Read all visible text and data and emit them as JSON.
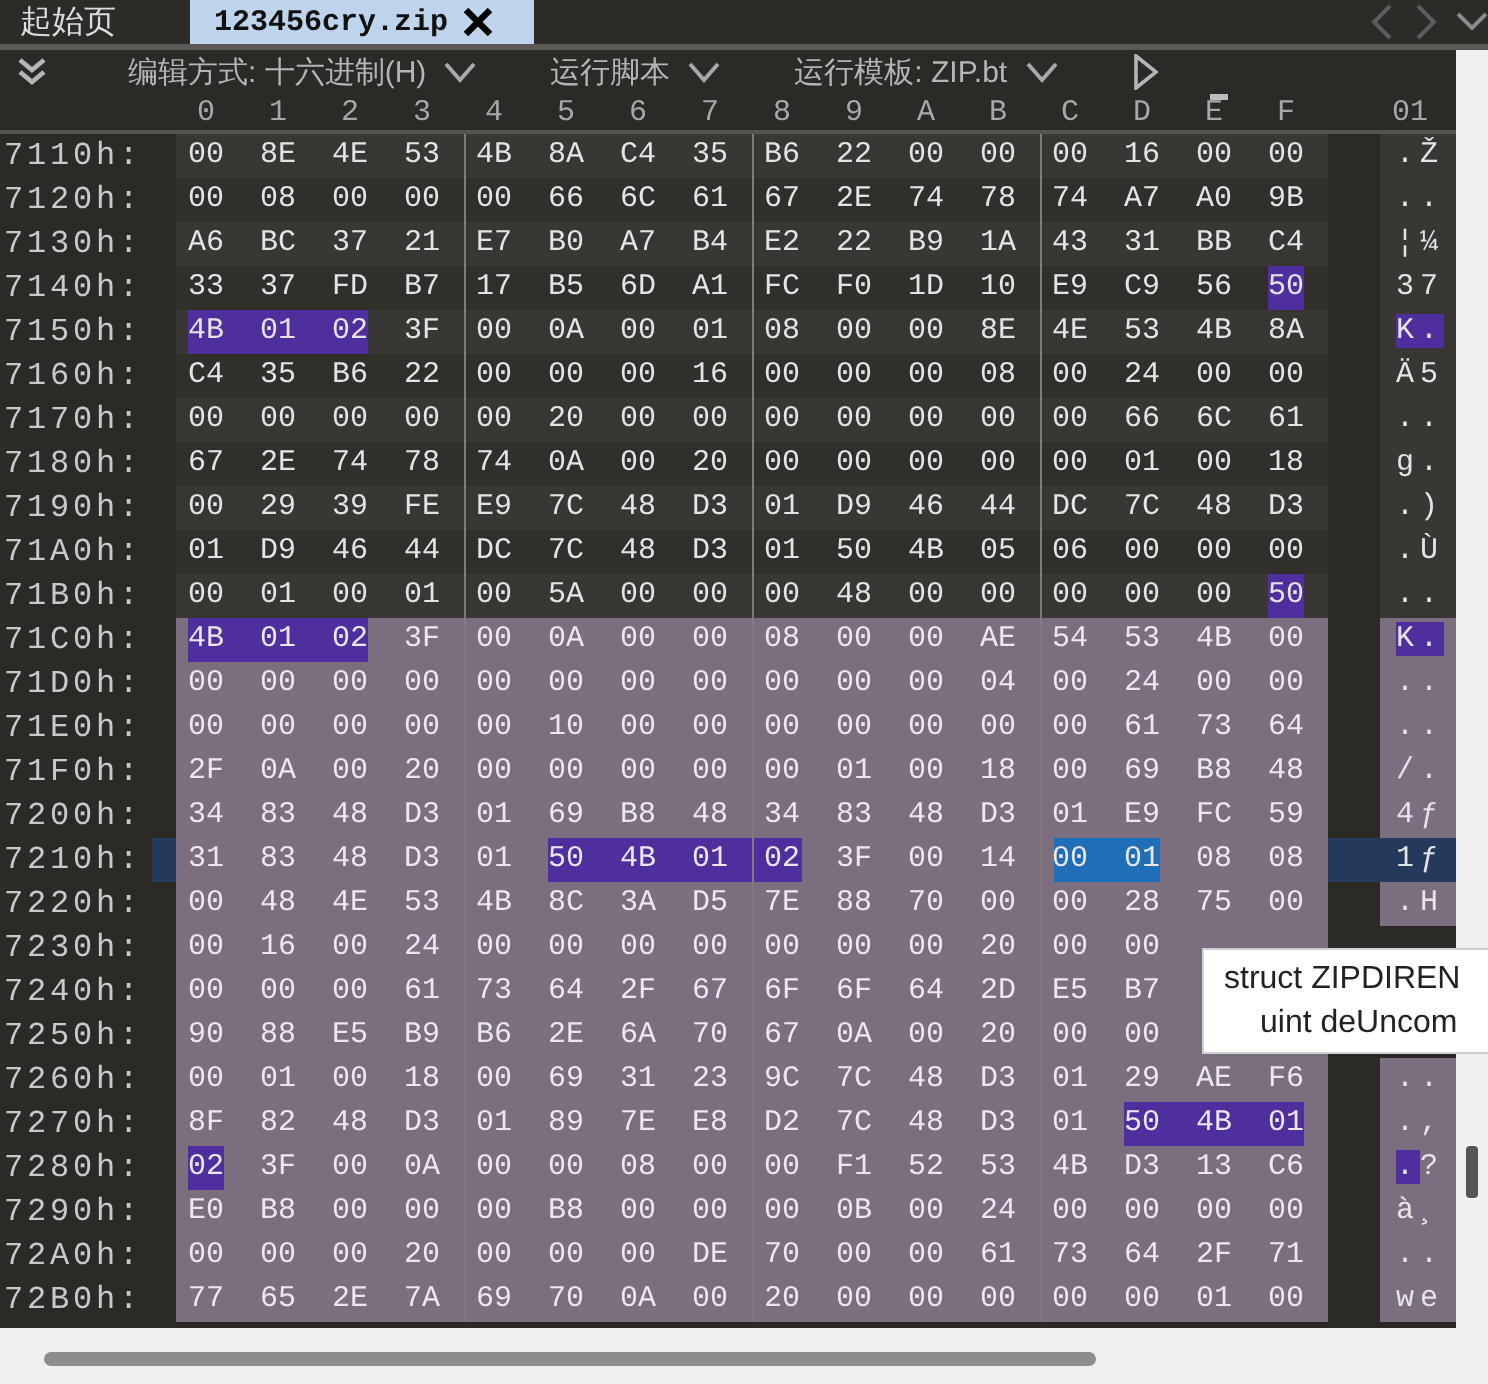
{
  "tabs": [
    {
      "label": "起始页",
      "selected": false
    },
    {
      "label": "123456cry.zip",
      "selected": true
    }
  ],
  "toolbar": {
    "dropdowns": [
      {
        "label": "编辑方式: 十六进制(H)"
      },
      {
        "label": "运行脚本"
      },
      {
        "label": "运行模板: ZIP.bt"
      }
    ]
  },
  "columns": [
    {
      "label": "0",
      "selected": false
    },
    {
      "label": "1",
      "selected": false
    },
    {
      "label": "2",
      "selected": false
    },
    {
      "label": "3",
      "selected": false
    },
    {
      "label": "4",
      "selected": false
    },
    {
      "label": "5",
      "selected": false
    },
    {
      "label": "6",
      "selected": false
    },
    {
      "label": "7",
      "selected": false
    },
    {
      "label": "8",
      "selected": false
    },
    {
      "label": "9",
      "selected": false
    },
    {
      "label": "A",
      "selected": false
    },
    {
      "label": "B",
      "selected": false
    },
    {
      "label": "C",
      "selected": false
    },
    {
      "label": "D",
      "selected": false
    },
    {
      "label": "E",
      "selected": true
    },
    {
      "label": "F",
      "selected": false
    }
  ],
  "ascii_header": "01",
  "rows": [
    {
      "address": "7110h:",
      "in_struct": false,
      "current": false,
      "segments": [
        {
          "kind": "plain",
          "bytes": [
            "00",
            "8E",
            "4E",
            "53",
            "4B",
            "8A",
            "C4",
            "35",
            "B6",
            "22",
            "00",
            "00",
            "00",
            "16",
            "00",
            "00"
          ]
        }
      ],
      "ascii": [
        {
          "kind": "plain",
          "text": ".Ž"
        }
      ]
    },
    {
      "address": "7120h:",
      "in_struct": false,
      "current": false,
      "segments": [
        {
          "kind": "plain",
          "bytes": [
            "00",
            "08",
            "00",
            "00",
            "00",
            "66",
            "6C",
            "61",
            "67",
            "2E",
            "74",
            "78",
            "74",
            "A7",
            "A0",
            "9B"
          ]
        }
      ],
      "ascii": [
        {
          "kind": "plain",
          "text": ".."
        }
      ]
    },
    {
      "address": "7130h:",
      "in_struct": false,
      "current": false,
      "segments": [
        {
          "kind": "plain",
          "bytes": [
            "A6",
            "BC",
            "37",
            "21",
            "E7",
            "B0",
            "A7",
            "B4",
            "E2",
            "22",
            "B9",
            "1A",
            "43",
            "31",
            "BB",
            "C4"
          ]
        }
      ],
      "ascii": [
        {
          "kind": "plain",
          "text": "¦¼"
        }
      ]
    },
    {
      "address": "7140h:",
      "in_struct": false,
      "current": false,
      "segments": [
        {
          "kind": "plain",
          "bytes": [
            "33",
            "37",
            "FD",
            "B7",
            "17",
            "B5",
            "6D",
            "A1",
            "FC",
            "F0",
            "1D",
            "10",
            "E9",
            "C9",
            "56"
          ]
        },
        {
          "kind": "signature",
          "bytes": [
            "50"
          ]
        }
      ],
      "ascii": [
        {
          "kind": "plain",
          "text": "37"
        }
      ]
    },
    {
      "address": "7150h:",
      "in_struct": false,
      "current": false,
      "segments": [
        {
          "kind": "signature",
          "bytes": [
            "4B",
            "01",
            "02"
          ]
        },
        {
          "kind": "plain",
          "bytes": [
            "3F",
            "00",
            "0A",
            "00",
            "01",
            "08",
            "00",
            "00",
            "8E",
            "4E",
            "53",
            "4B",
            "8A"
          ]
        }
      ],
      "ascii": [
        {
          "kind": "signature",
          "text": "K."
        }
      ]
    },
    {
      "address": "7160h:",
      "in_struct": false,
      "current": false,
      "segments": [
        {
          "kind": "plain",
          "bytes": [
            "C4",
            "35",
            "B6",
            "22",
            "00",
            "00",
            "00",
            "16",
            "00",
            "00",
            "00",
            "08",
            "00",
            "24",
            "00",
            "00"
          ]
        }
      ],
      "ascii": [
        {
          "kind": "plain",
          "text": "Ä5"
        }
      ]
    },
    {
      "address": "7170h:",
      "in_struct": false,
      "current": false,
      "segments": [
        {
          "kind": "plain",
          "bytes": [
            "00",
            "00",
            "00",
            "00",
            "00",
            "20",
            "00",
            "00",
            "00",
            "00",
            "00",
            "00",
            "00",
            "66",
            "6C",
            "61"
          ]
        }
      ],
      "ascii": [
        {
          "kind": "plain",
          "text": ".."
        }
      ]
    },
    {
      "address": "7180h:",
      "in_struct": false,
      "current": false,
      "segments": [
        {
          "kind": "plain",
          "bytes": [
            "67",
            "2E",
            "74",
            "78",
            "74",
            "0A",
            "00",
            "20",
            "00",
            "00",
            "00",
            "00",
            "00",
            "01",
            "00",
            "18"
          ]
        }
      ],
      "ascii": [
        {
          "kind": "plain",
          "text": "g."
        }
      ]
    },
    {
      "address": "7190h:",
      "in_struct": false,
      "current": false,
      "segments": [
        {
          "kind": "plain",
          "bytes": [
            "00",
            "29",
            "39",
            "FE",
            "E9",
            "7C",
            "48",
            "D3",
            "01",
            "D9",
            "46",
            "44",
            "DC",
            "7C",
            "48",
            "D3"
          ]
        }
      ],
      "ascii": [
        {
          "kind": "plain",
          "text": ".)"
        }
      ]
    },
    {
      "address": "71A0h:",
      "in_struct": false,
      "current": false,
      "segments": [
        {
          "kind": "plain",
          "bytes": [
            "01",
            "D9",
            "46",
            "44",
            "DC",
            "7C",
            "48",
            "D3",
            "01",
            "50",
            "4B",
            "05",
            "06",
            "00",
            "00",
            "00"
          ]
        }
      ],
      "ascii": [
        {
          "kind": "plain",
          "text": ".Ù"
        }
      ]
    },
    {
      "address": "71B0h:",
      "in_struct": false,
      "current": false,
      "segments": [
        {
          "kind": "plain",
          "bytes": [
            "00",
            "01",
            "00",
            "01",
            "00",
            "5A",
            "00",
            "00",
            "00",
            "48",
            "00",
            "00",
            "00",
            "00",
            "00"
          ]
        },
        {
          "kind": "signature",
          "bytes": [
            "50"
          ]
        }
      ],
      "ascii": [
        {
          "kind": "plain",
          "text": ".."
        }
      ]
    },
    {
      "address": "71C0h:",
      "in_struct": true,
      "current": false,
      "segments": [
        {
          "kind": "signature",
          "bytes": [
            "4B",
            "01",
            "02"
          ]
        },
        {
          "kind": "plain",
          "bytes": [
            "3F",
            "00",
            "0A",
            "00",
            "00",
            "08",
            "00",
            "00",
            "AE",
            "54",
            "53",
            "4B",
            "00"
          ]
        }
      ],
      "ascii": [
        {
          "kind": "signature",
          "text": "K."
        }
      ]
    },
    {
      "address": "71D0h:",
      "in_struct": true,
      "current": false,
      "segments": [
        {
          "kind": "plain",
          "bytes": [
            "00",
            "00",
            "00",
            "00",
            "00",
            "00",
            "00",
            "00",
            "00",
            "00",
            "00",
            "04",
            "00",
            "24",
            "00",
            "00"
          ]
        }
      ],
      "ascii": [
        {
          "kind": "plain",
          "text": ".."
        }
      ]
    },
    {
      "address": "71E0h:",
      "in_struct": true,
      "current": false,
      "segments": [
        {
          "kind": "plain",
          "bytes": [
            "00",
            "00",
            "00",
            "00",
            "00",
            "10",
            "00",
            "00",
            "00",
            "00",
            "00",
            "00",
            "00",
            "61",
            "73",
            "64"
          ]
        }
      ],
      "ascii": [
        {
          "kind": "plain",
          "text": ".."
        }
      ]
    },
    {
      "address": "71F0h:",
      "in_struct": true,
      "current": false,
      "segments": [
        {
          "kind": "plain",
          "bytes": [
            "2F",
            "0A",
            "00",
            "20",
            "00",
            "00",
            "00",
            "00",
            "00",
            "01",
            "00",
            "18",
            "00",
            "69",
            "B8",
            "48"
          ]
        }
      ],
      "ascii": [
        {
          "kind": "plain",
          "text": "/."
        }
      ]
    },
    {
      "address": "7200h:",
      "in_struct": true,
      "current": false,
      "segments": [
        {
          "kind": "plain",
          "bytes": [
            "34",
            "83",
            "48",
            "D3",
            "01",
            "69",
            "B8",
            "48",
            "34",
            "83",
            "48",
            "D3",
            "01",
            "E9",
            "FC",
            "59"
          ]
        }
      ],
      "ascii": [
        {
          "kind": "plain",
          "text": "4ƒ"
        }
      ]
    },
    {
      "address": "7210h:",
      "in_struct": true,
      "current": true,
      "segments": [
        {
          "kind": "plain",
          "bytes": [
            "31",
            "83",
            "48",
            "D3",
            "01"
          ]
        },
        {
          "kind": "signature",
          "bytes": [
            "50",
            "4B",
            "01",
            "02"
          ]
        },
        {
          "kind": "plain",
          "bytes": [
            "3F",
            "00",
            "14"
          ]
        },
        {
          "kind": "selected",
          "bytes": [
            "00",
            "01"
          ]
        },
        {
          "kind": "plain",
          "bytes": [
            "08",
            "08"
          ]
        }
      ],
      "ascii": [
        {
          "kind": "plain",
          "text": "1ƒ"
        }
      ]
    },
    {
      "address": "7220h:",
      "in_struct": true,
      "current": false,
      "segments": [
        {
          "kind": "plain",
          "bytes": [
            "00",
            "48",
            "4E",
            "53",
            "4B",
            "8C",
            "3A",
            "D5",
            "7E",
            "88",
            "70",
            "00",
            "00",
            "28",
            "75",
            "00"
          ]
        }
      ],
      "ascii": [
        {
          "kind": "plain",
          "text": ".H"
        }
      ]
    },
    {
      "address": "7230h:",
      "in_struct": true,
      "current": false,
      "segments": [
        {
          "kind": "plain",
          "bytes": [
            "00",
            "16",
            "00",
            "24",
            "00",
            "00",
            "00",
            "00",
            "00",
            "00",
            "00",
            "20",
            "00",
            "00"
          ]
        }
      ]
    },
    {
      "address": "7240h:",
      "in_struct": true,
      "current": false,
      "segments": [
        {
          "kind": "plain",
          "bytes": [
            "00",
            "00",
            "00",
            "61",
            "73",
            "64",
            "2F",
            "67",
            "6F",
            "6F",
            "64",
            "2D",
            "E5",
            "B7"
          ]
        }
      ]
    },
    {
      "address": "7250h:",
      "in_struct": true,
      "current": false,
      "segments": [
        {
          "kind": "plain",
          "bytes": [
            "90",
            "88",
            "E5",
            "B9",
            "B6",
            "2E",
            "6A",
            "70",
            "67",
            "0A",
            "00",
            "20",
            "00",
            "00"
          ]
        }
      ]
    },
    {
      "address": "7260h:",
      "in_struct": true,
      "current": false,
      "segments": [
        {
          "kind": "plain",
          "bytes": [
            "00",
            "01",
            "00",
            "18",
            "00",
            "69",
            "31",
            "23",
            "9C",
            "7C",
            "48",
            "D3",
            "01",
            "29",
            "AE",
            "F6"
          ]
        }
      ],
      "ascii": [
        {
          "kind": "plain",
          "text": ".."
        }
      ]
    },
    {
      "address": "7270h:",
      "in_struct": true,
      "current": false,
      "segments": [
        {
          "kind": "plain",
          "bytes": [
            "8F",
            "82",
            "48",
            "D3",
            "01",
            "89",
            "7E",
            "E8",
            "D2",
            "7C",
            "48",
            "D3",
            "01"
          ]
        },
        {
          "kind": "signature",
          "bytes": [
            "50",
            "4B",
            "01"
          ]
        }
      ],
      "ascii": [
        {
          "kind": "plain",
          "text": ".,"
        }
      ]
    },
    {
      "address": "7280h:",
      "in_struct": true,
      "current": false,
      "segments": [
        {
          "kind": "signature",
          "bytes": [
            "02"
          ]
        },
        {
          "kind": "plain",
          "bytes": [
            "3F",
            "00",
            "0A",
            "00",
            "00",
            "08",
            "00",
            "00",
            "F1",
            "52",
            "53",
            "4B",
            "D3",
            "13",
            "C6"
          ]
        }
      ],
      "ascii": [
        {
          "kind": "signature",
          "text": "."
        },
        {
          "kind": "plain",
          "text": "?"
        }
      ]
    },
    {
      "address": "7290h:",
      "in_struct": true,
      "current": false,
      "segments": [
        {
          "kind": "plain",
          "bytes": [
            "E0",
            "B8",
            "00",
            "00",
            "00",
            "B8",
            "00",
            "00",
            "00",
            "0B",
            "00",
            "24",
            "00",
            "00",
            "00",
            "00"
          ]
        }
      ],
      "ascii": [
        {
          "kind": "plain",
          "text": "à¸"
        }
      ]
    },
    {
      "address": "72A0h:",
      "in_struct": true,
      "current": false,
      "segments": [
        {
          "kind": "plain",
          "bytes": [
            "00",
            "00",
            "00",
            "20",
            "00",
            "00",
            "00",
            "DE",
            "70",
            "00",
            "00",
            "61",
            "73",
            "64",
            "2F",
            "71"
          ]
        }
      ],
      "ascii": [
        {
          "kind": "plain",
          "text": ".."
        }
      ]
    },
    {
      "address": "72B0h:",
      "in_struct": true,
      "current": false,
      "segments": [
        {
          "kind": "plain",
          "bytes": [
            "77",
            "65",
            "2E",
            "7A",
            "69",
            "70",
            "0A",
            "00",
            "20",
            "00",
            "00",
            "00",
            "00",
            "00",
            "01",
            "00"
          ]
        }
      ],
      "ascii": [
        {
          "kind": "plain",
          "text": "we"
        }
      ]
    }
  ],
  "tooltip": {
    "lines": [
      "struct ZIPDIREN",
      "uint deUncom"
    ]
  }
}
